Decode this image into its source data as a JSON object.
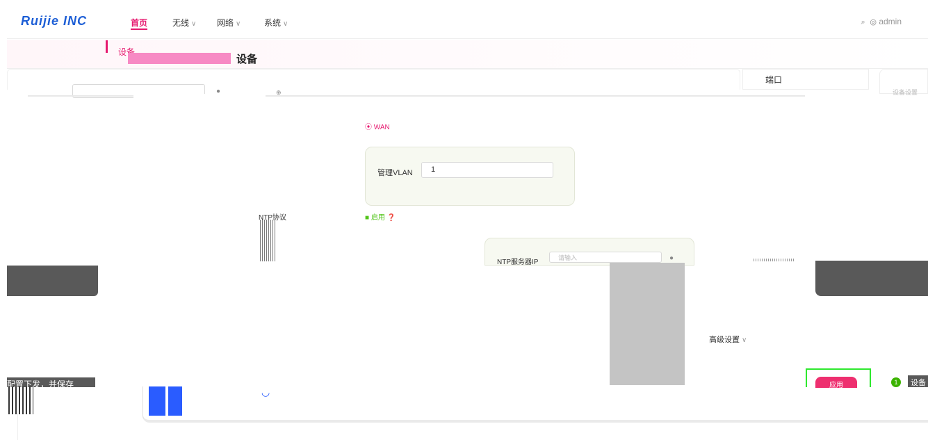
{
  "header": {
    "logo": "Ruijie INC",
    "nav": [
      {
        "label": "首页"
      },
      {
        "label": "无线"
      },
      {
        "label": "网络"
      },
      {
        "label": "系统"
      }
    ],
    "user": "admin"
  },
  "sidebar": {
    "active_item": "设备"
  },
  "page": {
    "title": "设备"
  },
  "tabs": {
    "port": "端口",
    "device_settings": "设备设置"
  },
  "wifi": {
    "label": "WAN"
  },
  "vlan": {
    "label": "管理VLAN",
    "value": "1"
  },
  "ntp": {
    "protocol_label": "NTP协议",
    "toggle_label": "启用",
    "server_label": "NTP服务器IP",
    "server_placeholder": "请输入"
  },
  "advanced": {
    "label": "高级设置"
  },
  "footer": {
    "deploy_label": "配置下发，并保存",
    "apply_label": "应用",
    "notice_count": "1",
    "tip_label": "设备"
  },
  "colors": {
    "accent": "#e6196f",
    "brand_blue": "#1e5fd6",
    "success": "#52c41a"
  }
}
